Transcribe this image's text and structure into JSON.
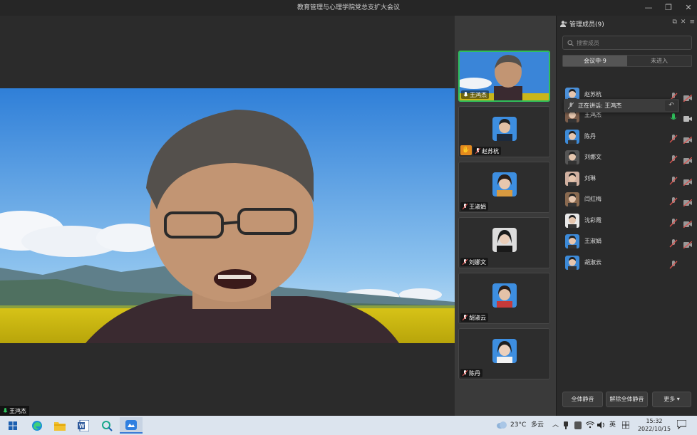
{
  "window": {
    "title": "教育管理与心理学院党总支扩大会议",
    "minimize": "—",
    "restore": "❐",
    "close": "✕"
  },
  "main_video": {
    "self_label": "王鸿杰"
  },
  "thumbnails": [
    {
      "name": "王鸿杰",
      "active": true,
      "video": true
    },
    {
      "name": "赵苏杭",
      "hand_raised": true
    },
    {
      "name": "王淑娟"
    },
    {
      "name": "刘娜文"
    },
    {
      "name": "胡淑云"
    },
    {
      "name": "陈丹"
    }
  ],
  "panel": {
    "title": "管理成员(9)",
    "search_placeholder": "搜索成员",
    "tabs": [
      {
        "label": "会议中·9",
        "selected": true
      },
      {
        "label": "未进入",
        "selected": false
      }
    ],
    "speaking_prefix": "正在讲话: 王鸿杰",
    "members": [
      {
        "name": "赵苏杭",
        "mic": "muted",
        "cam": "off",
        "avatar_color": "#4a90d9"
      },
      {
        "name": "王鸿杰",
        "mic": "active",
        "cam": "on",
        "avatar_color": "#7a5c4a"
      },
      {
        "name": "陈丹",
        "mic": "muted",
        "cam": "off",
        "avatar_color": "#3c8ad8"
      },
      {
        "name": "刘娜文",
        "mic": "muted",
        "cam": "off",
        "avatar_color": "#555555"
      },
      {
        "name": "刘琳",
        "mic": "muted",
        "cam": "off",
        "avatar_color": "#d0b0a0"
      },
      {
        "name": "闫红梅",
        "mic": "muted",
        "cam": "off",
        "avatar_color": "#8a6a50"
      },
      {
        "name": "沈彩霞",
        "mic": "muted",
        "cam": "off",
        "avatar_color": "#e8e8e8"
      },
      {
        "name": "王淑娟",
        "mic": "muted",
        "cam": "off",
        "avatar_color": "#3c8ad8"
      },
      {
        "name": "胡淑云",
        "mic": "muted",
        "cam": "none",
        "avatar_color": "#3c8ad8"
      }
    ],
    "buttons": {
      "mute_all": "全体静音",
      "unmute_all": "解除全体静音",
      "more": "更多 ▾"
    }
  },
  "taskbar": {
    "weather_temp": "23°C",
    "weather_desc": "多云",
    "ime": "英",
    "time": "15:32",
    "date": "2022/10/15"
  },
  "colors": {
    "active_green": "#2fbf5b",
    "hand_orange": "#e48a1e",
    "muted_red": "#d9534f"
  }
}
